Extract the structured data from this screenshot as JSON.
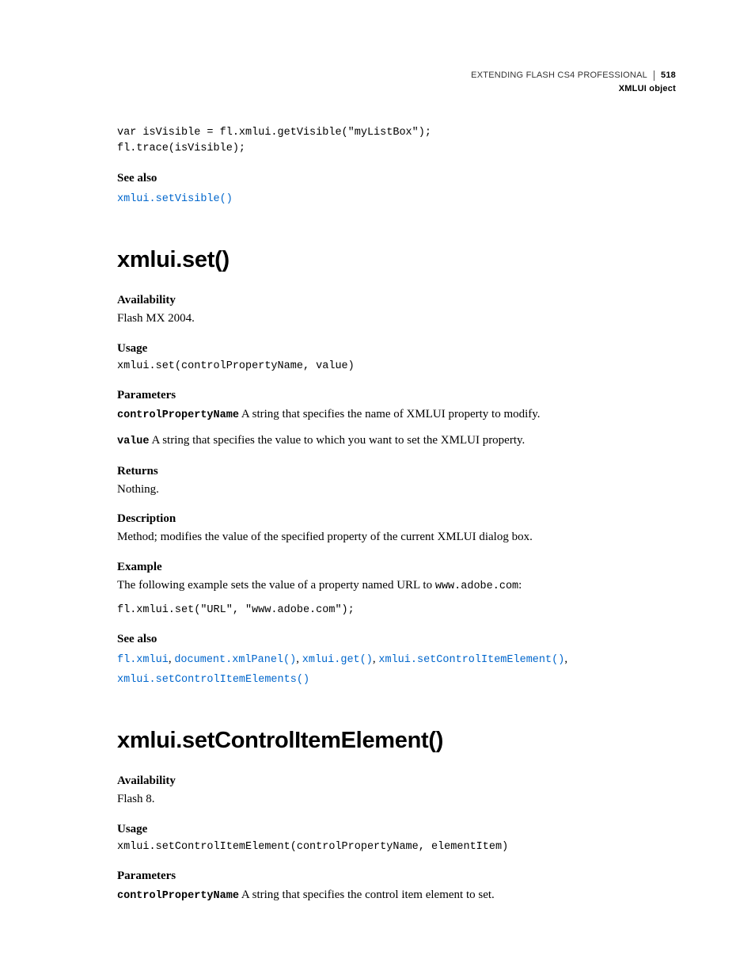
{
  "header": {
    "title": "EXTENDING FLASH CS4 PROFESSIONAL",
    "page_number": "518",
    "section": "XMLUI object"
  },
  "block0": {
    "code": "var isVisible = fl.xmlui.getVisible(\"myListBox\");\nfl.trace(isVisible);",
    "seealso_label": "See also",
    "seealso_link": "xmlui.setVisible()"
  },
  "method1": {
    "heading": "xmlui.set()",
    "availability_label": "Availability",
    "availability_text": "Flash MX 2004.",
    "usage_label": "Usage",
    "usage_code": "xmlui.set(controlPropertyName, value)",
    "parameters_label": "Parameters",
    "param1_name": "controlPropertyName",
    "param1_desc": "  A string that specifies the name of XMLUI property to modify.",
    "param2_name": "value",
    "param2_desc": "  A string that specifies the value to which you want to set the XMLUI property.",
    "returns_label": "Returns",
    "returns_text": "Nothing.",
    "description_label": "Description",
    "description_text": "Method; modifies the value of the specified property of the current XMLUI dialog box.",
    "example_label": "Example",
    "example_intro_pre": "The following example sets the value of a property named URL to ",
    "example_intro_code": "www.adobe.com",
    "example_intro_post": ":",
    "example_code": "fl.xmlui.set(\"URL\", \"www.adobe.com\");",
    "seealso_label": "See also",
    "seealso_l1": "fl.xmlui",
    "seealso_l2": "document.xmlPanel()",
    "seealso_l3": "xmlui.get()",
    "seealso_l4": "xmlui.setControlItemElement()",
    "seealso_l5": "xmlui.setControlItemElements()",
    "comma": ", "
  },
  "method2": {
    "heading": "xmlui.setControlItemElement()",
    "availability_label": "Availability",
    "availability_text": "Flash 8.",
    "usage_label": "Usage",
    "usage_code": "xmlui.setControlItemElement(controlPropertyName, elementItem)",
    "parameters_label": "Parameters",
    "param1_name": "controlPropertyName",
    "param1_desc": "  A string that specifies the control item element to set."
  }
}
